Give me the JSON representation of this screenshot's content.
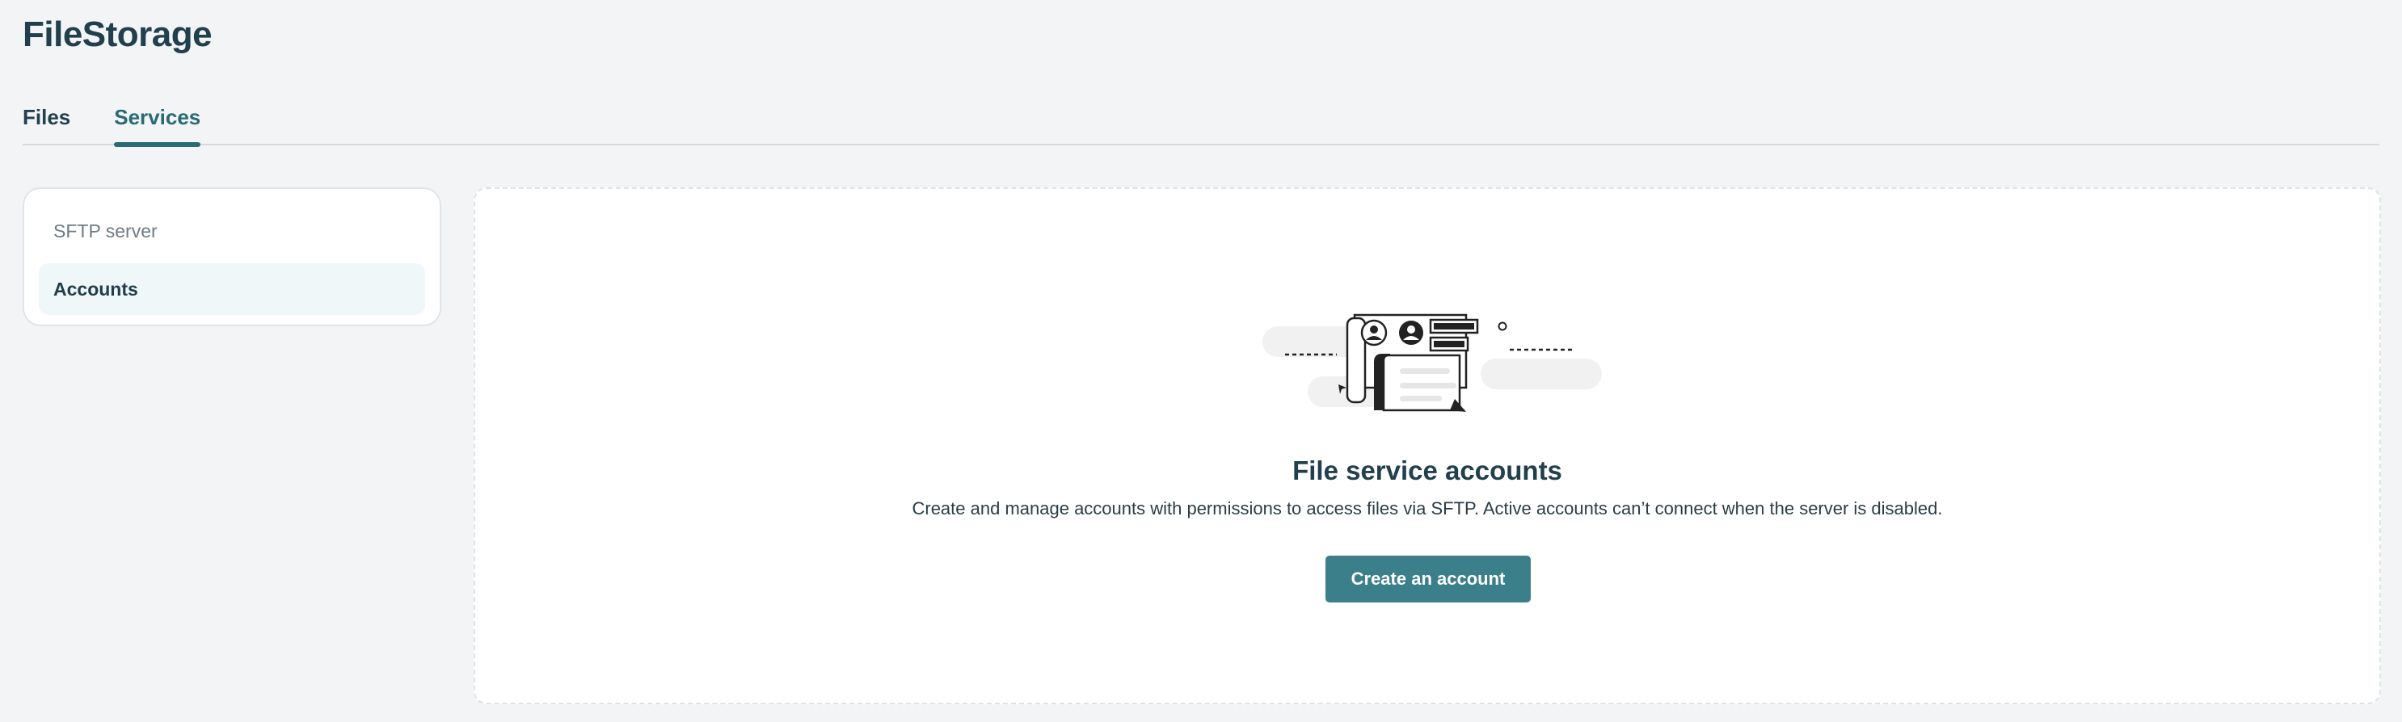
{
  "app": {
    "title": "FileStorage"
  },
  "tabs": [
    {
      "label": "Files",
      "active": false
    },
    {
      "label": "Services",
      "active": true
    }
  ],
  "sidebar": {
    "items": [
      {
        "label": "SFTP server",
        "selected": false
      },
      {
        "label": "Accounts",
        "selected": true
      }
    ]
  },
  "empty_state": {
    "illustration": "accounts-illustration-icon",
    "title": "File service accounts",
    "description": "Create and manage accounts with permissions to access files via SFTP. Active accounts can’t connect when the server is disabled.",
    "button_label": "Create an account"
  },
  "colors": {
    "accent": "#2c6b73",
    "button": "#3a7f8a",
    "page_background": "#f3f4f6",
    "selected_item_background": "#eff7f8"
  }
}
